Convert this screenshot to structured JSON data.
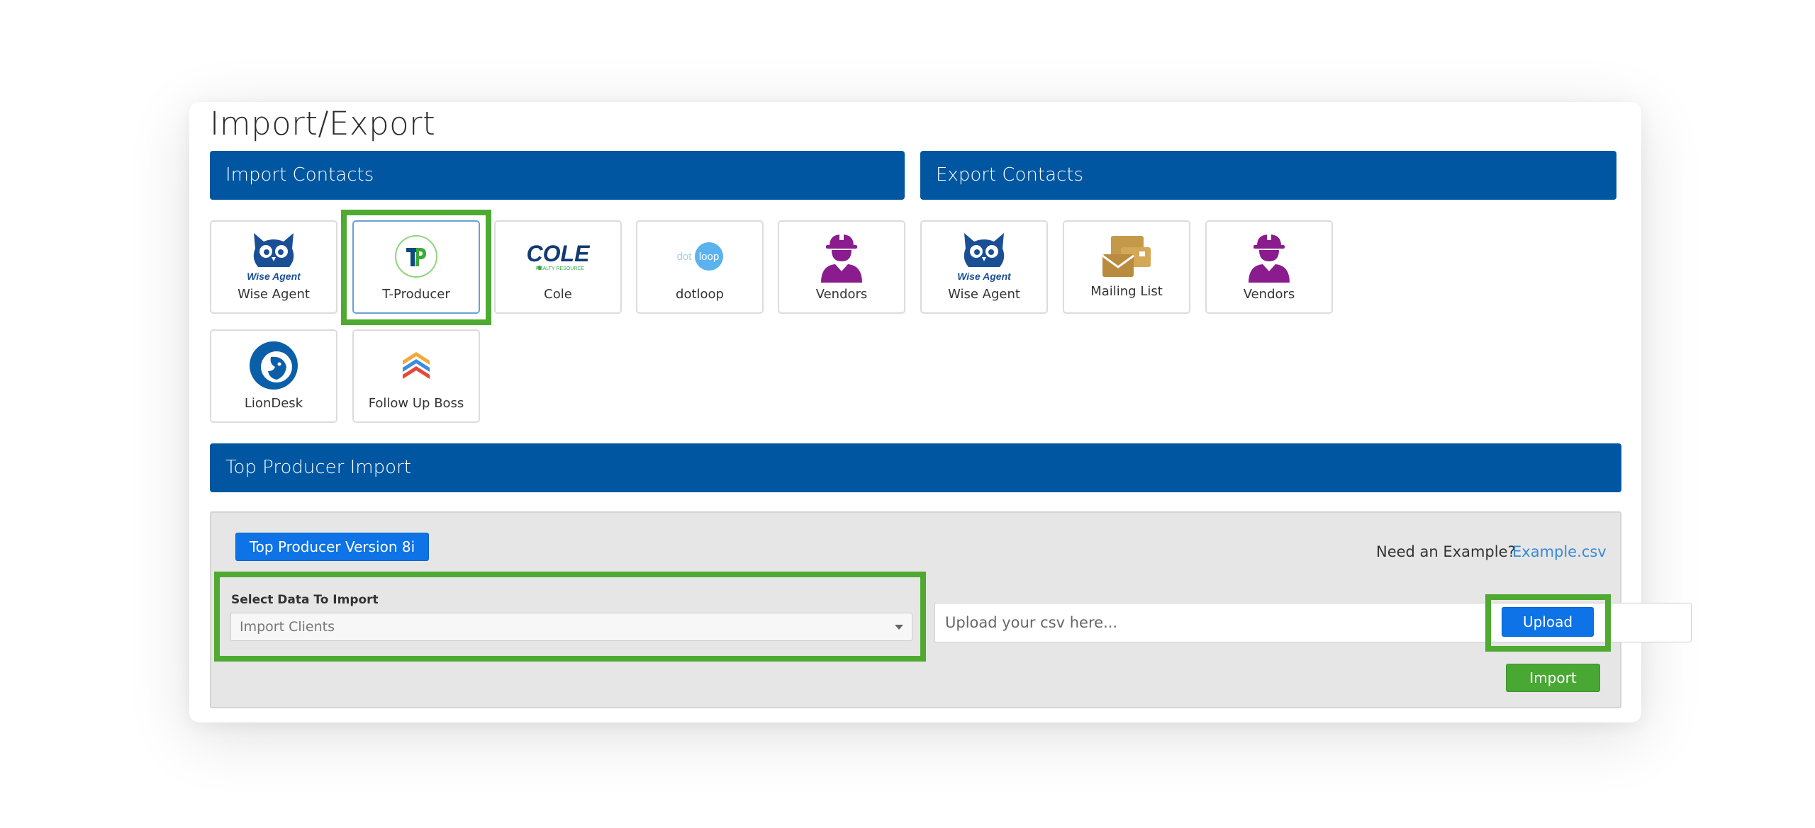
{
  "page": {
    "title": "Import/Export"
  },
  "import_section": {
    "title": "Import Contacts",
    "tiles": [
      {
        "label": "Wise Agent",
        "icon": "wise-agent-owl-icon"
      },
      {
        "label": "T-Producer",
        "icon": "top-producer-tp-icon",
        "selected": true
      },
      {
        "label": "Cole",
        "icon": "cole-logo-icon",
        "logo_text": "COLE",
        "logo_subtext": "REALTY RESOURCE"
      },
      {
        "label": "dotloop",
        "icon": "dotloop-logo-icon",
        "logo_text": "dot",
        "logo_text2": "loop"
      },
      {
        "label": "Vendors",
        "icon": "vendor-worker-icon"
      },
      {
        "label": "LionDesk",
        "icon": "liondesk-lion-icon"
      },
      {
        "label": "Follow Up Boss",
        "icon": "follow-up-boss-chevrons-icon"
      }
    ]
  },
  "export_section": {
    "title": "Export Contacts",
    "tiles": [
      {
        "label": "Wise Agent",
        "icon": "wise-agent-owl-icon"
      },
      {
        "label": "Mailing List",
        "icon": "mailing-list-envelope-icon"
      },
      {
        "label": "Vendors",
        "icon": "vendor-worker-icon"
      }
    ]
  },
  "import_panel": {
    "title": "Top Producer Import",
    "version_button": "Top Producer Version 8i",
    "example_prompt": "Need an Example?",
    "example_link": "Example.csv",
    "select_label": "Select Data To Import",
    "select_value": "Import Clients",
    "upload_placeholder": "Upload your csv here...",
    "upload_button": "Upload",
    "import_button": "Import"
  },
  "colors": {
    "section_bar": "#0056a0",
    "primary_button": "#0d73e6",
    "success_button": "#48a833",
    "highlight": "#4faa32",
    "brand_purple": "#8a1c8e",
    "wise_agent_blue": "#1a4f96",
    "link": "#3a8bd6"
  }
}
